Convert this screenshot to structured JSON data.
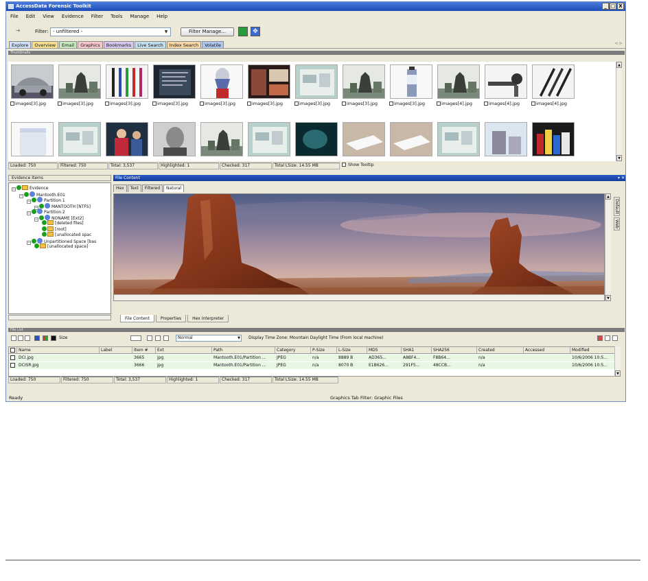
{
  "window": {
    "title": "AccessData Forensic Toolkit",
    "min": "_",
    "max": "□",
    "close": "X"
  },
  "menu": [
    "File",
    "Edit",
    "View",
    "Evidence",
    "Filter",
    "Tools",
    "Manage",
    "Help"
  ],
  "toolbar": {
    "filter_label": "Filter:",
    "filter_value": "- unfiltered -",
    "filter_manager": "Filter Manage..."
  },
  "tabs": [
    {
      "label": "Explore",
      "color": "#cfe0f8"
    },
    {
      "label": "Overview",
      "color": "#f8e08a"
    },
    {
      "label": "Email",
      "color": "#c8e8c0"
    },
    {
      "label": "Graphics",
      "color": "#f8c8d0"
    },
    {
      "label": "Bookmarks",
      "color": "#d8c8f0"
    },
    {
      "label": "Live Search",
      "color": "#c0e0f0"
    },
    {
      "label": "Index Search",
      "color": "#f8d8a8"
    },
    {
      "label": "Volatile",
      "color": "#b0c8f0"
    }
  ],
  "thumbnails_header": "Thumbnails",
  "thumbnails": [
    {
      "caption": "images[3].jpg",
      "kind": "car"
    },
    {
      "caption": "images[3].jpg",
      "kind": "statue"
    },
    {
      "caption": "images[3].jpg",
      "kind": "pens-color"
    },
    {
      "caption": "images[3].jpg",
      "kind": "dark-doc"
    },
    {
      "caption": "images[3].jpg",
      "kind": "bust"
    },
    {
      "caption": "images[3].jpg",
      "kind": "poster"
    },
    {
      "caption": "images[3].jpg",
      "kind": "drawing"
    },
    {
      "caption": "images[3].jpg",
      "kind": "statue"
    },
    {
      "caption": "images[3].jpg",
      "kind": "bottle"
    },
    {
      "caption": "images[4].jpg",
      "kind": "statue"
    },
    {
      "caption": "images[4].jpg",
      "kind": "tool"
    },
    {
      "caption": "images[4].jpg",
      "kind": "pens"
    },
    {
      "caption": "",
      "kind": "box"
    },
    {
      "caption": "",
      "kind": "drawing"
    },
    {
      "caption": "",
      "kind": "people"
    },
    {
      "caption": "",
      "kind": "portrait"
    },
    {
      "caption": "",
      "kind": "statue"
    },
    {
      "caption": "",
      "kind": "drawing"
    },
    {
      "caption": "",
      "kind": "teal"
    },
    {
      "caption": "",
      "kind": "white"
    },
    {
      "caption": "",
      "kind": "white"
    },
    {
      "caption": "",
      "kind": "drawing"
    },
    {
      "caption": "",
      "kind": "building"
    },
    {
      "caption": "",
      "kind": "products"
    }
  ],
  "thumb_status": [
    "Loaded: 750",
    "Filtered: 750",
    "Total: 3,537",
    "Highlighted: 1",
    "Checked: 317",
    "Total LSize: 14.55 MB",
    "Show Tooltip"
  ],
  "evidence_panel_title": "Evidence Items",
  "evidence_tree": [
    {
      "label": "Evidence",
      "depth": 0,
      "icon": "folder-blue"
    },
    {
      "label": "Mantooth.E01",
      "depth": 1,
      "icon": "drive"
    },
    {
      "label": "Partition 1",
      "depth": 2,
      "icon": "disk"
    },
    {
      "label": "MANTOOTH [NTFS]",
      "depth": 3,
      "icon": "volume"
    },
    {
      "label": "Partition 2",
      "depth": 2,
      "icon": "disk"
    },
    {
      "label": "NONAME [Ext2]",
      "depth": 3,
      "icon": "volume"
    },
    {
      "label": "[deleted files]",
      "depth": 4,
      "icon": "folder"
    },
    {
      "label": "[root]",
      "depth": 4,
      "icon": "folder"
    },
    {
      "label": "[unallocated spac",
      "depth": 4,
      "icon": "folder"
    },
    {
      "label": "Unpartitioned Space [bas",
      "depth": 2,
      "icon": "disk"
    },
    {
      "label": "[unallocated space]",
      "depth": 3,
      "icon": "folder"
    }
  ],
  "file_content_title": "File Content",
  "file_content_tabs": [
    "Hex",
    "Text",
    "Filtered",
    "Natural"
  ],
  "side_tabs": [
    "Default",
    "Web"
  ],
  "bottom_tabs": [
    "File Content",
    "Properties",
    "Hex Interpreter"
  ],
  "file_list_header": "File List",
  "file_list_toolbar": {
    "size_value": "Normal",
    "timezone": "Display Time Zone: Mountain Daylight Time  (From local machine)",
    "size_label": "Size"
  },
  "columns": [
    "Name",
    "Label",
    "Item #",
    "Ext",
    "Path",
    "Category",
    "P-Size",
    "L-Size",
    "MD5",
    "SHA1",
    "SHA256",
    "Created",
    "Accessed",
    "Modified"
  ],
  "rows": [
    [
      "DCI.jpg",
      "",
      "3665",
      "jpg",
      "Mantooth.E01/Partition ...",
      "JPEG",
      "n/a",
      "8889 B",
      "AD365...",
      "A8BF4...",
      "F8B64...",
      "n/a",
      "",
      "10/6/2006 10:5..."
    ],
    [
      "DCISR.jpg",
      "",
      "3666",
      "jpg",
      "Mantooth.E01/Partition ...",
      "JPEG",
      "n/a",
      "8070 B",
      "E1B626...",
      "291F5...",
      "48CCB...",
      "n/a",
      "",
      "10/6/2006 10:5..."
    ]
  ],
  "list_status": [
    "Loaded: 750",
    "Filtered: 750",
    "Total: 3,537",
    "Highlighted: 1",
    "Checked: 317",
    "Total LSize: 14.55 MB"
  ],
  "status": {
    "left": "Ready",
    "center": "Graphics Tab Filter: Graphic Files"
  }
}
